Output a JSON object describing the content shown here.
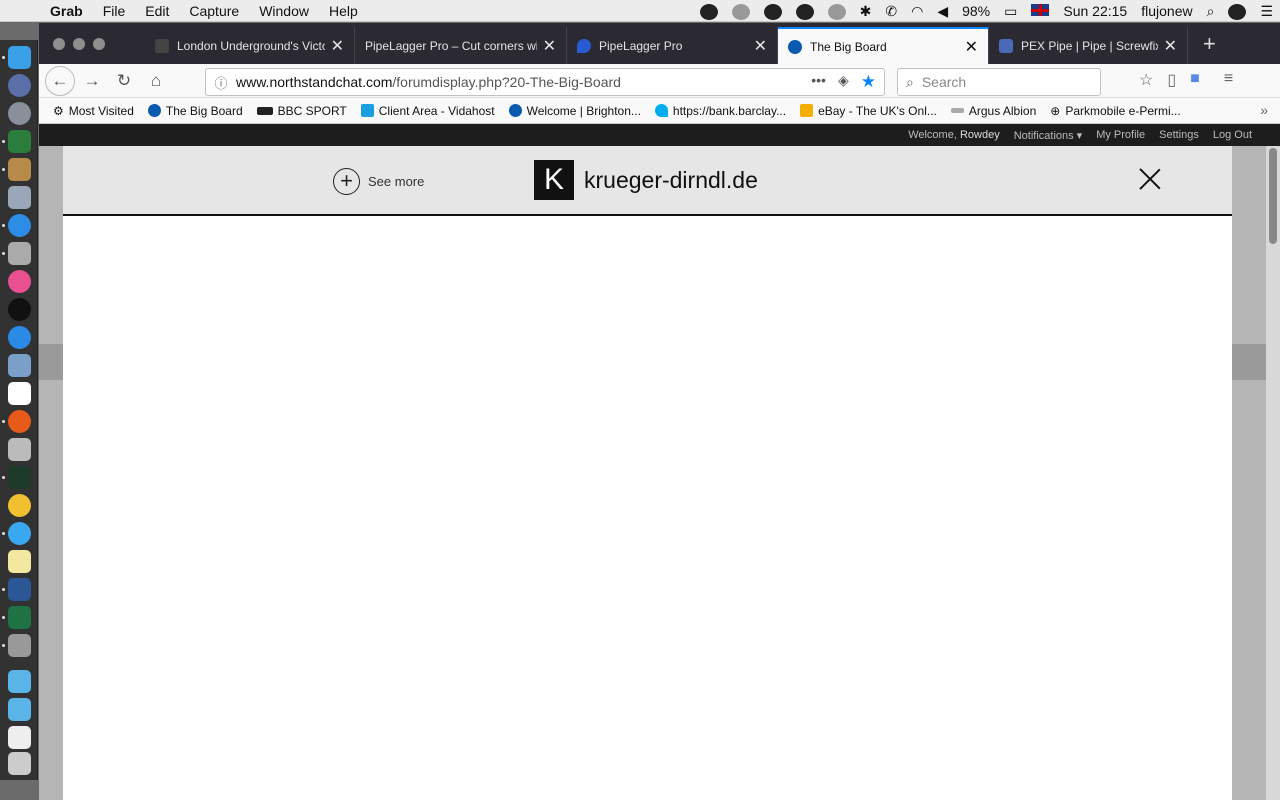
{
  "menubar": {
    "app_name": "Grab",
    "menus": [
      "File",
      "Edit",
      "Capture",
      "Window",
      "Help"
    ],
    "battery": "98%",
    "clock": "Sun 22:15",
    "user": "flujonew"
  },
  "tabs": [
    {
      "label": "London Underground's Victo",
      "favicon": "bbc-icon"
    },
    {
      "label": "PipeLagger Pro – Cut corners wi",
      "favicon": ""
    },
    {
      "label": "PipeLagger Pro",
      "favicon": "drop-icon"
    },
    {
      "label": "The Big Board",
      "favicon": "forum-icon",
      "active": true
    },
    {
      "label": "PEX Pipe | Pipe | Screwfix.co",
      "favicon": "screwfix-icon"
    }
  ],
  "navbar": {
    "url_host": "www.northstandchat.com",
    "url_path": "/forumdisplay.php?20-The-Big-Board",
    "search_placeholder": "Search"
  },
  "bookmarks": [
    {
      "label": "Most Visited",
      "icon": "gear-icon"
    },
    {
      "label": "The Big Board",
      "icon": "forum-icon"
    },
    {
      "label": "BBC SPORT",
      "icon": "bbc-icon"
    },
    {
      "label": "Client Area - Vidahost",
      "icon": "vidahost-icon"
    },
    {
      "label": "Welcome | Brighton...",
      "icon": "forum-icon"
    },
    {
      "label": "https://bank.barclay...",
      "icon": "barclays-icon"
    },
    {
      "label": "eBay - The UK's Onl...",
      "icon": "ebay-icon"
    },
    {
      "label": "Argus Albion",
      "icon": "argus-icon"
    },
    {
      "label": "Parkmobile e-Permi...",
      "icon": "globe-icon"
    }
  ],
  "forum_bar": {
    "welcome": "Welcome,",
    "username": "Rowdey",
    "notifications": "Notifications",
    "profile": "My Profile",
    "settings": "Settings",
    "logout": "Log Out"
  },
  "overlay": {
    "see_more": "See more",
    "logo_letter": "K",
    "brand": "krueger-dirndl.de"
  },
  "colors": {
    "accent": "#0a84ff",
    "tabbar": "#2b2a33",
    "forum_bar": "#1d1d1d"
  }
}
